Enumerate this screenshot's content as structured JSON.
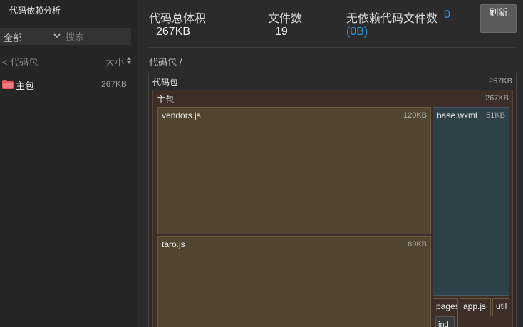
{
  "sidebar": {
    "title": "代码依赖分析",
    "filter_value": "全部",
    "search_placeholder": "搜索",
    "back_label": "< 代码包",
    "sort_label": "大小",
    "packages": [
      {
        "name": "主包",
        "size": "267KB"
      }
    ]
  },
  "stats": {
    "total_size_label": "代码总体积",
    "total_size_value": "267KB",
    "file_count_label": "文件数",
    "file_count_value": "19",
    "no_dep_label": "无依赖代码文件数",
    "no_dep_count": "0",
    "no_dep_size": "(0B)"
  },
  "refresh_label": "刷新",
  "breadcrumb": "代码包 /",
  "treemap": {
    "root": {
      "label": "代码包",
      "size": "267KB"
    },
    "main": {
      "label": "主包",
      "size": "267KB"
    },
    "files": [
      {
        "label": "vendors.js",
        "size": "120KB"
      },
      {
        "label": "taro.js",
        "size": "89KB"
      },
      {
        "label": "base.wxml",
        "size": "51KB"
      },
      {
        "label": "pages"
      },
      {
        "label": "app.js"
      },
      {
        "label": "util"
      },
      {
        "label": "ind"
      },
      {
        "label": ".."
      }
    ]
  },
  "colors": {
    "accent": "#1f9ce8",
    "js_file": "#514530",
    "wxml_file": "#2e4048",
    "package": "#3d2f27",
    "folder_icon": "#e8565c"
  }
}
